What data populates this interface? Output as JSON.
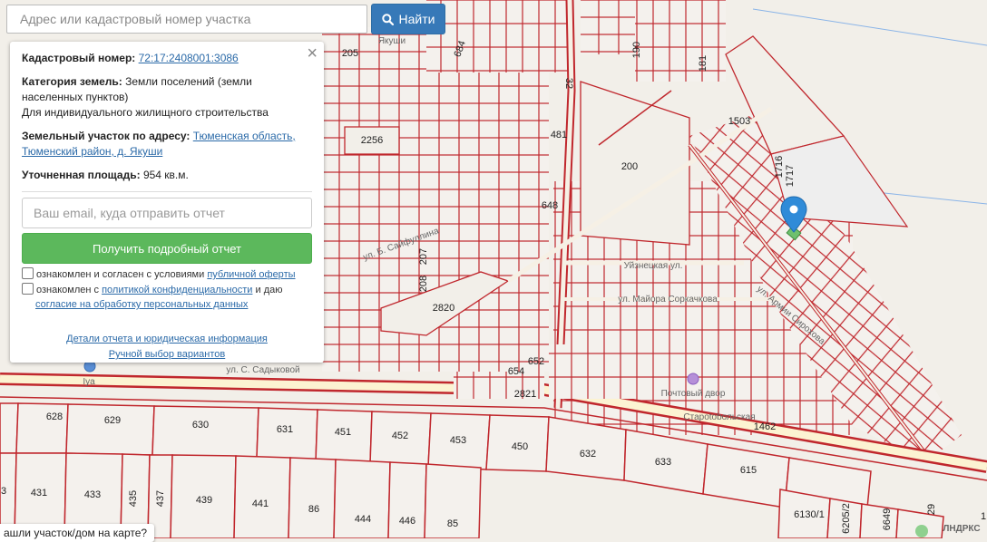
{
  "search": {
    "placeholder": "Адрес или кадастровый номер участка",
    "button_label": "Найти"
  },
  "info_panel": {
    "close_symbol": "×",
    "cadastral_label": "Кадастровый номер:",
    "cadastral_number": "72:17:2408001:3086",
    "category_label": "Категория земель:",
    "category_value": "Земли поселений (земли населенных пунктов)",
    "usage": "Для индивидуального жилищного строительства",
    "address_label": "Земельный участок по адресу:",
    "address_value": "Тюменская область, Тюменский район, д. Якуши",
    "area_label": "Уточненная площадь:",
    "area_value": "954 кв.м.",
    "email_placeholder": "Ваш email, куда отправить отчет",
    "report_button": "Получить подробный отчет",
    "consent1_text": "ознакомлен и согласен с условиями",
    "consent1_link": "публичной оферты",
    "consent2_text": "ознакомлен с",
    "consent2_link1": "политикой конфиденциальности",
    "consent2_mid": "и даю",
    "consent2_link2": "согласие на обработку персональных данных",
    "details_link": "Детали отчета и юридическая информация",
    "manual_link": "Ручной выбор вариантов"
  },
  "bottom_prompt": "ашли участок/дом на карте?",
  "map": {
    "parcel_color": "#c0272d",
    "road_color": "#fdf6d8",
    "background": "#f2efe9",
    "marker_color": "#2f8bd8",
    "parcel_numbers": [
      {
        "label": "205"
      },
      {
        "label": "684"
      },
      {
        "label": "32"
      },
      {
        "label": "190"
      },
      {
        "label": "181"
      },
      {
        "label": "2256"
      },
      {
        "label": "481"
      },
      {
        "label": "200"
      },
      {
        "label": "1503"
      },
      {
        "label": "1716"
      },
      {
        "label": "1717"
      },
      {
        "label": "648"
      },
      {
        "label": "207"
      },
      {
        "label": "208"
      },
      {
        "label": "2820"
      },
      {
        "label": "654"
      },
      {
        "label": "652"
      },
      {
        "label": "2821"
      },
      {
        "label": "1462"
      },
      {
        "label": "628"
      },
      {
        "label": "629"
      },
      {
        "label": "630"
      },
      {
        "label": "631"
      },
      {
        "label": "451"
      },
      {
        "label": "452"
      },
      {
        "label": "453"
      },
      {
        "label": "450"
      },
      {
        "label": "632"
      },
      {
        "label": "633"
      },
      {
        "label": "615"
      },
      {
        "label": "431"
      },
      {
        "label": "433"
      },
      {
        "label": "435"
      },
      {
        "label": "437"
      },
      {
        "label": "439"
      },
      {
        "label": "441"
      },
      {
        "label": "86"
      },
      {
        "label": "444"
      },
      {
        "label": "446"
      },
      {
        "label": "85"
      },
      {
        "label": "6130/1"
      },
      {
        "label": "6205/2"
      },
      {
        "label": "6649"
      },
      {
        "label": "29"
      },
      {
        "label": "3"
      },
      {
        "label": "1"
      }
    ],
    "place_labels": [
      {
        "label": "Якуши"
      },
      {
        "label": "ул. С. Садыковой"
      },
      {
        "label": "Староtobольская"
      },
      {
        "label": "ул. Майора Соркачкова"
      },
      {
        "label": "ул. Б. Сайфуллина"
      },
      {
        "label": "Уйзнецкая ул."
      },
      {
        "label": "ул. Армии Сирохова"
      },
      {
        "label": "Почтовый двор"
      },
      {
        "label": "Iya"
      },
      {
        "label": "ЛНДРКС"
      }
    ]
  }
}
